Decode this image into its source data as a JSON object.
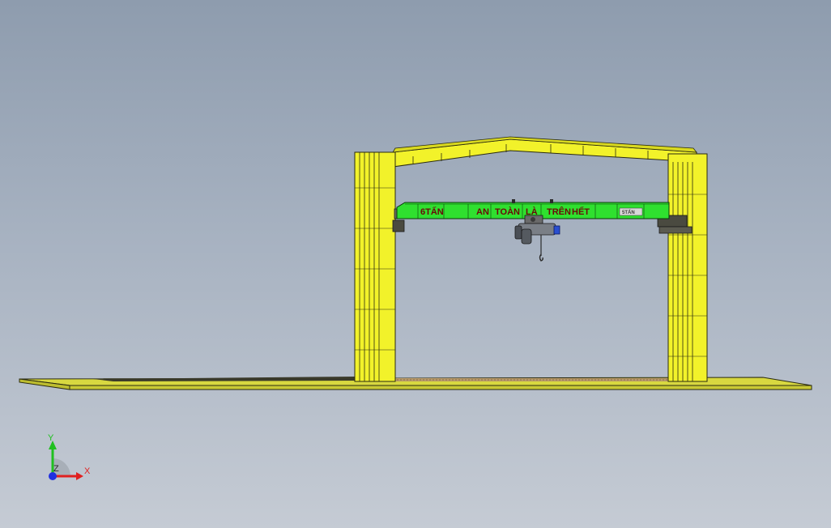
{
  "beam": {
    "labels": [
      "6TẤN",
      "AN",
      "TOÀN",
      "LÀ",
      "TRÊN",
      "HẾT"
    ],
    "plate": "5TẤN"
  },
  "triad": {
    "x_label": "X",
    "y_label": "Y",
    "z_label": "Z"
  },
  "colors": {
    "frame": "#f2f22a",
    "frame_edge": "#2a2a10",
    "beam": "#2fe02f",
    "beam_text": "#6a0a0a",
    "floor": "#d8d840",
    "background_top": "#8e9cae",
    "background_bottom": "#c5cbd4",
    "axis_x": "#e02020",
    "axis_y": "#20c020",
    "axis_z": "#2030e0"
  }
}
